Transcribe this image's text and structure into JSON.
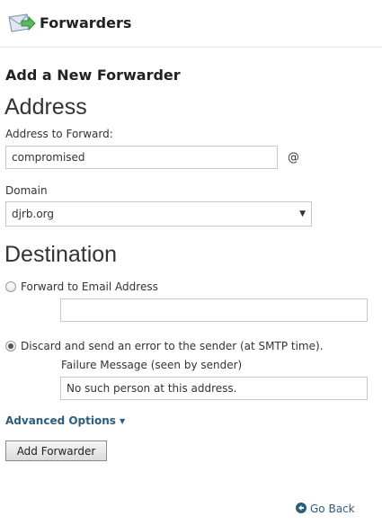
{
  "header": {
    "title": "Forwarders",
    "icon": "envelope-forward-icon"
  },
  "form": {
    "heading": "Add a New Forwarder",
    "address_section": {
      "title": "Address",
      "address_label": "Address to Forward:",
      "address_value": "compromised",
      "at_symbol": "@",
      "domain_label": "Domain",
      "domain_value": "djrb.org"
    },
    "destination_section": {
      "title": "Destination",
      "option_forward": {
        "label": "Forward to Email Address",
        "selected": false,
        "value": ""
      },
      "option_discard": {
        "label": "Discard and send an error to the sender (at SMTP time).",
        "selected": true,
        "failure_label": "Failure Message (seen by sender)",
        "failure_value": "No such person at this address."
      }
    },
    "advanced_label": "Advanced Options",
    "submit_label": "Add Forwarder"
  },
  "footer": {
    "go_back_label": "Go Back"
  },
  "colors": {
    "link": "#2b5d7e",
    "text": "#333333",
    "border": "#c8c8c8"
  }
}
